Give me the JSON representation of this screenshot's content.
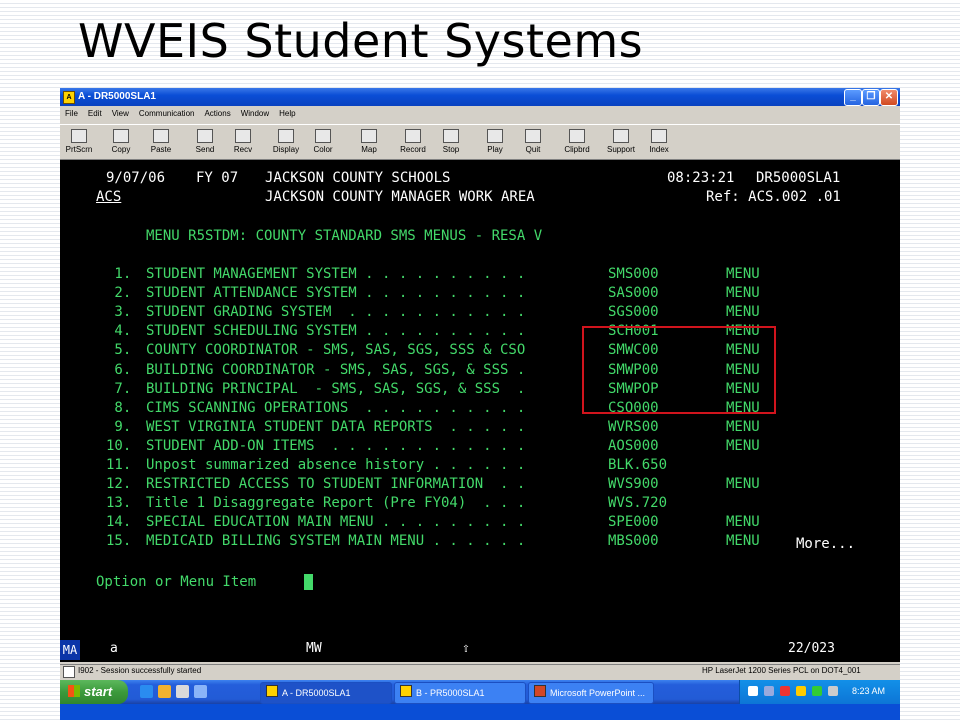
{
  "slide": {
    "title": "WVEIS Student Systems"
  },
  "window": {
    "title": "A - DR5000SLA1",
    "menu": [
      "File",
      "Edit",
      "View",
      "Communication",
      "Actions",
      "Window",
      "Help"
    ],
    "toolbar": [
      "PrtScrn",
      "Copy",
      "Paste",
      "Send",
      "Recv",
      "Display",
      "Color",
      "Map",
      "Record",
      "Stop",
      "Play",
      "Quit",
      "Clipbrd",
      "Support",
      "Index"
    ]
  },
  "terminal": {
    "header": {
      "date": "9/07/06",
      "fy": "FY 07",
      "district": "JACKSON COUNTY SCHOOLS",
      "time": "08:23:21",
      "session": "DR5000SLA1",
      "area_code": "ACS",
      "area": "JACKSON COUNTY MANAGER WORK AREA",
      "ref": "Ref: ACS.002 .01"
    },
    "menu_title": "MENU R5STDM: COUNTY STANDARD SMS MENUS - RESA V",
    "items": [
      {
        "num": " 1.",
        "label": "STUDENT MANAGEMENT SYSTEM . . . . . . . . . .",
        "code": "SMS000",
        "type": "MENU"
      },
      {
        "num": " 2.",
        "label": "STUDENT ATTENDANCE SYSTEM . . . . . . . . . .",
        "code": "SAS000",
        "type": "MENU"
      },
      {
        "num": " 3.",
        "label": "STUDENT GRADING SYSTEM  . . . . . . . . . . .",
        "code": "SGS000",
        "type": "MENU"
      },
      {
        "num": " 4.",
        "label": "STUDENT SCHEDULING SYSTEM . . . . . . . . . .",
        "code": "SCH001",
        "type": "MENU"
      },
      {
        "num": " 5.",
        "label": "COUNTY COORDINATOR - SMS, SAS, SGS, SSS & CSO",
        "code": "SMWC00",
        "type": "MENU"
      },
      {
        "num": " 6.",
        "label": "BUILDING COORDINATOR - SMS, SAS, SGS, & SSS .",
        "code": "SMWP00",
        "type": "MENU"
      },
      {
        "num": " 7.",
        "label": "BUILDING PRINCIPAL  - SMS, SAS, SGS, & SSS  .",
        "code": "SMWPOP",
        "type": "MENU"
      },
      {
        "num": " 8.",
        "label": "CIMS SCANNING OPERATIONS  . . . . . . . . . .",
        "code": "CSO000",
        "type": "MENU"
      },
      {
        "num": " 9.",
        "label": "WEST VIRGINIA STUDENT DATA REPORTS  . . . . .",
        "code": "WVRS00",
        "type": "MENU"
      },
      {
        "num": "10.",
        "label": "STUDENT ADD-ON ITEMS  . . . . . . . . . . . .",
        "code": "AOS000",
        "type": "MENU"
      },
      {
        "num": "11.",
        "label": "Unpost summarized absence history . . . . . .",
        "code": "BLK.650",
        "type": ""
      },
      {
        "num": "12.",
        "label": "RESTRICTED ACCESS TO STUDENT INFORMATION  . .",
        "code": "WVS900",
        "type": "MENU"
      },
      {
        "num": "13.",
        "label": "Title 1 Disaggregate Report (Pre FY04)  . . .",
        "code": "WVS.720",
        "type": ""
      },
      {
        "num": "14.",
        "label": "SPECIAL EDUCATION MAIN MENU . . . . . . . . .",
        "code": "SPE000",
        "type": "MENU"
      },
      {
        "num": "15.",
        "label": "MEDICAID BILLING SYSTEM MAIN MENU . . . . . .",
        "code": "MBS000",
        "type": "MENU"
      }
    ],
    "more": "More...",
    "prompt": "Option or Menu Item",
    "input_value": ""
  },
  "status": {
    "oia": "MA",
    "mode": "a",
    "mw": "MW",
    "arrow": "⇧",
    "position": "22/023"
  },
  "sessionbar": {
    "message": "I902 - Session successfully started",
    "printer": "HP LaserJet 1200 Series PCL on DOT4_001"
  },
  "taskbar": {
    "start": "start",
    "tasks": [
      "A - DR5000SLA1",
      "B - PR5000SLA1",
      "Microsoft PowerPoint ..."
    ],
    "clock": "8:23 AM"
  }
}
